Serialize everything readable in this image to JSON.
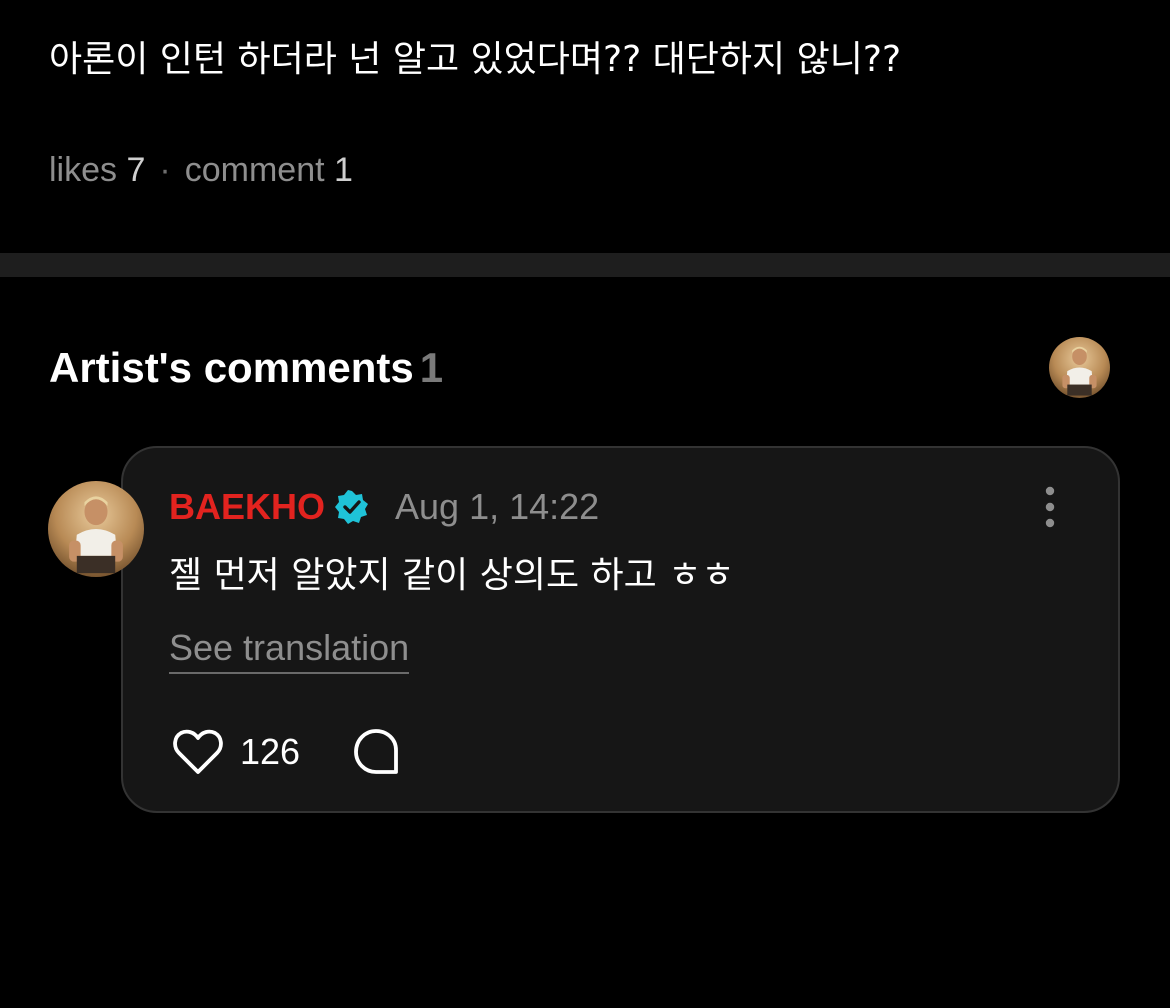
{
  "post": {
    "text": "아론이 인턴 하더라 넌 알고 있었다며?? 대단하지 않니??",
    "likes_label": "likes",
    "likes_count": "7",
    "separator": "·",
    "comment_label": "comment",
    "comment_count": "1"
  },
  "artist_comments": {
    "title": "Artist's comments",
    "count": "1"
  },
  "comment": {
    "author": "BAEKHO",
    "time": "Aug 1, 14:22",
    "text": "젤 먼저 알았지 같이 상의도 하고 ㅎㅎ",
    "translate_label": "See translation",
    "like_count": "126"
  },
  "icons": {
    "verified": "verified-badge-icon",
    "more": "more-vertical-icon",
    "like": "heart-outline-icon",
    "reply": "speech-bubble-icon"
  },
  "colors": {
    "background": "#000000",
    "card": "#161616",
    "author_name": "#e2231f",
    "verified_badge": "#1fc3d8",
    "muted_text": "#8e8e8e"
  }
}
